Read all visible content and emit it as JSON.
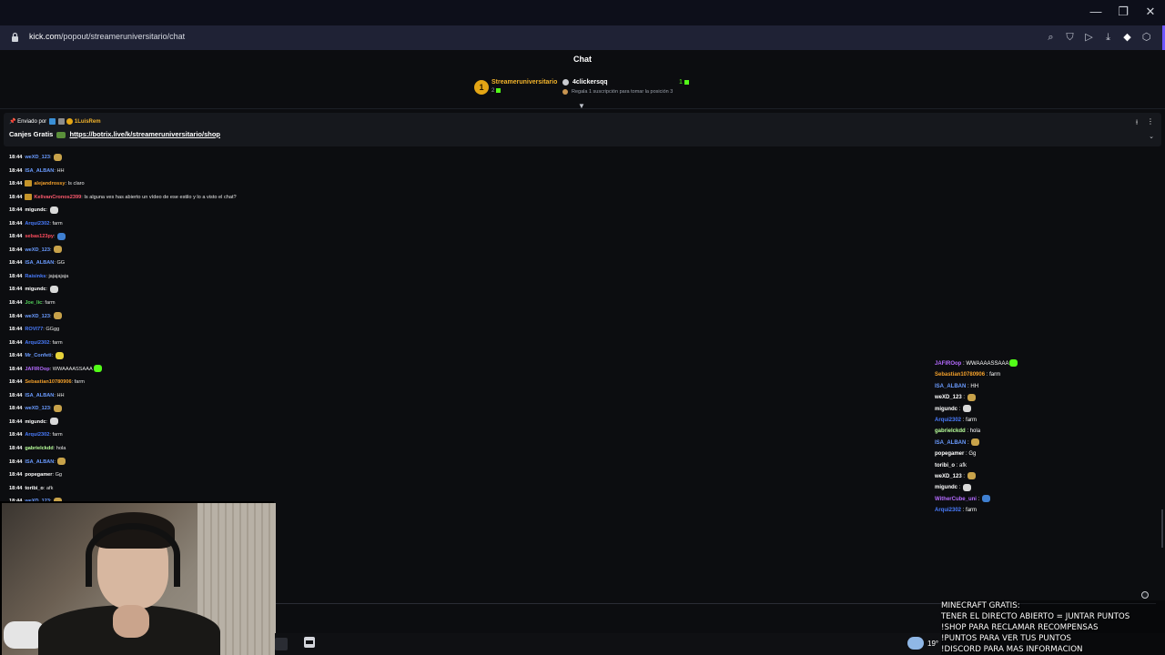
{
  "browser": {
    "url_host": "kick.com",
    "url_path": "/popout/streameruniversitario/chat"
  },
  "chat": {
    "title": "Chat",
    "top_gifters": {
      "first": {
        "rank": "1",
        "name": "Streameruniversitario",
        "count": "2"
      },
      "second": {
        "name": "4clickersqq",
        "count": "1",
        "hint": "Regala 1 suscripción para tomar la posición 3"
      }
    },
    "pinned": {
      "sent_by_label": "Enviado por",
      "sender": "1LuisRem",
      "label": "Canjes Gratis",
      "link": "https://botrix.live/k/streameruniversitario/shop"
    },
    "messages": [
      {
        "time": "18:44",
        "user": "weXD_123",
        "color": "#6a9bff",
        "text": "",
        "emote": "#c8a24a"
      },
      {
        "time": "18:44",
        "user": "ISA_ALBAN",
        "color": "#6a9bff",
        "text": "HH"
      },
      {
        "time": "18:44",
        "user": "alejandrossy",
        "color": "#f3a02b",
        "text": "Is claro",
        "badge": "#c4942a"
      },
      {
        "time": "18:44",
        "user": "KelivanCronos2399",
        "color": "#ff5a6e",
        "text": "Is alguna ves has abierto un vídeo de ese estilo y lo a visto el chat?",
        "badge": "#c4942a"
      },
      {
        "time": "18:44",
        "user": "migundc",
        "color": "#ffffff",
        "text": "",
        "emote": "#d9d9d9"
      },
      {
        "time": "18:44",
        "user": "Arqui2302",
        "color": "#4a7dff",
        "text": "farm"
      },
      {
        "time": "18:44",
        "user": "sebas123py",
        "color": "#ff4d5e",
        "text": "",
        "emote": "#3f7fd1"
      },
      {
        "time": "18:44",
        "user": "weXD_123",
        "color": "#6a9bff",
        "text": "",
        "emote": "#c8a24a"
      },
      {
        "time": "18:44",
        "user": "ISA_ALBAN",
        "color": "#6a9bff",
        "text": "GG"
      },
      {
        "time": "18:44",
        "user": "Raisinks",
        "color": "#4a7dff",
        "text": "jajajajaja"
      },
      {
        "time": "18:44",
        "user": "migundc",
        "color": "#ffffff",
        "text": "",
        "emote": "#d9d9d9"
      },
      {
        "time": "18:44",
        "user": "Joe_lic",
        "color": "#53d35a",
        "text": "farm"
      },
      {
        "time": "18:44",
        "user": "weXD_123",
        "color": "#6a9bff",
        "text": "",
        "emote": "#c8a24a"
      },
      {
        "time": "18:44",
        "user": "ROVI77",
        "color": "#4a7dff",
        "text": "GGgg"
      },
      {
        "time": "18:44",
        "user": "Arqui2302",
        "color": "#4a7dff",
        "text": "farm"
      },
      {
        "time": "18:44",
        "user": "Mr_Confeti",
        "color": "#6a9bff",
        "text": "",
        "emote": "#e6d23a"
      },
      {
        "time": "18:44",
        "user": "JAFIROop",
        "color": "#b56bff",
        "text": "WWAAAASSAAA",
        "emote": "#53fc18"
      },
      {
        "time": "18:44",
        "user": "Sebastian10780906",
        "color": "#f3a02b",
        "text": "farm"
      },
      {
        "time": "18:44",
        "user": "ISA_ALBAN",
        "color": "#6a9bff",
        "text": "HH"
      },
      {
        "time": "18:44",
        "user": "weXD_123",
        "color": "#6a9bff",
        "text": "",
        "emote": "#c8a24a"
      },
      {
        "time": "18:44",
        "user": "migundc",
        "color": "#ffffff",
        "text": "",
        "emote": "#d9d9d9"
      },
      {
        "time": "18:44",
        "user": "Arqui2302",
        "color": "#4a7dff",
        "text": "farm"
      },
      {
        "time": "18:44",
        "user": "gabrielckdd",
        "color": "#b8ff9a",
        "text": "hola"
      },
      {
        "time": "18:44",
        "user": "ISA_ALBAN",
        "color": "#6a9bff",
        "text": "",
        "emote": "#c8a24a"
      },
      {
        "time": "18:44",
        "user": "popegamer",
        "color": "#ffffff",
        "text": "Gg"
      },
      {
        "time": "18:44",
        "user": "toribi_o",
        "color": "#ffffff",
        "text": "afk"
      },
      {
        "time": "18:44",
        "user": "weXD_123",
        "color": "#6a9bff",
        "text": "",
        "emote": "#c8a24a"
      }
    ]
  },
  "overlay_chat": [
    {
      "user": "JAFIROop",
      "color": "#b56bff",
      "text": "WWAAAASSAAA",
      "emote": "#53fc18"
    },
    {
      "user": "Sebastian10780906",
      "color": "#f3a02b",
      "text": "farm"
    },
    {
      "user": "ISA_ALBAN",
      "color": "#6a9bff",
      "text": "HH"
    },
    {
      "user": "weXD_123",
      "color": "#ffffff",
      "text": "",
      "emote": "#c8a24a"
    },
    {
      "user": "migundc",
      "color": "#ffffff",
      "text": "",
      "emote": "#d9d9d9"
    },
    {
      "user": "Arqui2302",
      "color": "#4a7dff",
      "text": "farm"
    },
    {
      "user": "gabrielckdd",
      "color": "#b8ff9a",
      "text": "hola"
    },
    {
      "user": "ISA_ALBAN",
      "color": "#6a9bff",
      "text": "",
      "emote": "#c8a24a"
    },
    {
      "user": "popegamer",
      "color": "#ffffff",
      "text": "Gg"
    },
    {
      "user": "toribi_o",
      "color": "#ffffff",
      "text": "afk"
    },
    {
      "user": "weXD_123",
      "color": "#ffffff",
      "text": "",
      "emote": "#c8a24a"
    },
    {
      "user": "migundc",
      "color": "#ffffff",
      "text": "",
      "emote": "#d9d9d9"
    },
    {
      "user": "WitherCube_uni",
      "color": "#b56bff",
      "text": "",
      "emote": "#3f7fd1"
    },
    {
      "user": "Arqui2302",
      "color": "#4a7dff",
      "text": "farm"
    }
  ],
  "taskbar": {
    "temperature": "19°"
  },
  "stream_info": [
    "MINECRAFT GRATIS:",
    "TENER EL DIRECTO ABIERTO = JUNTAR PUNTOS",
    "!SHOP PARA RECLAMAR RECOMPENSAS",
    "!PUNTOS PARA VER TUS PUNTOS",
    "!DISCORD PARA MAS INFORMACION"
  ],
  "icons": {
    "lock": "lock-icon",
    "search": "search-icon",
    "shield": "shield-icon",
    "play": "play-icon",
    "download": "download-icon",
    "extension": "extension-icon",
    "pin": "pin-icon"
  }
}
